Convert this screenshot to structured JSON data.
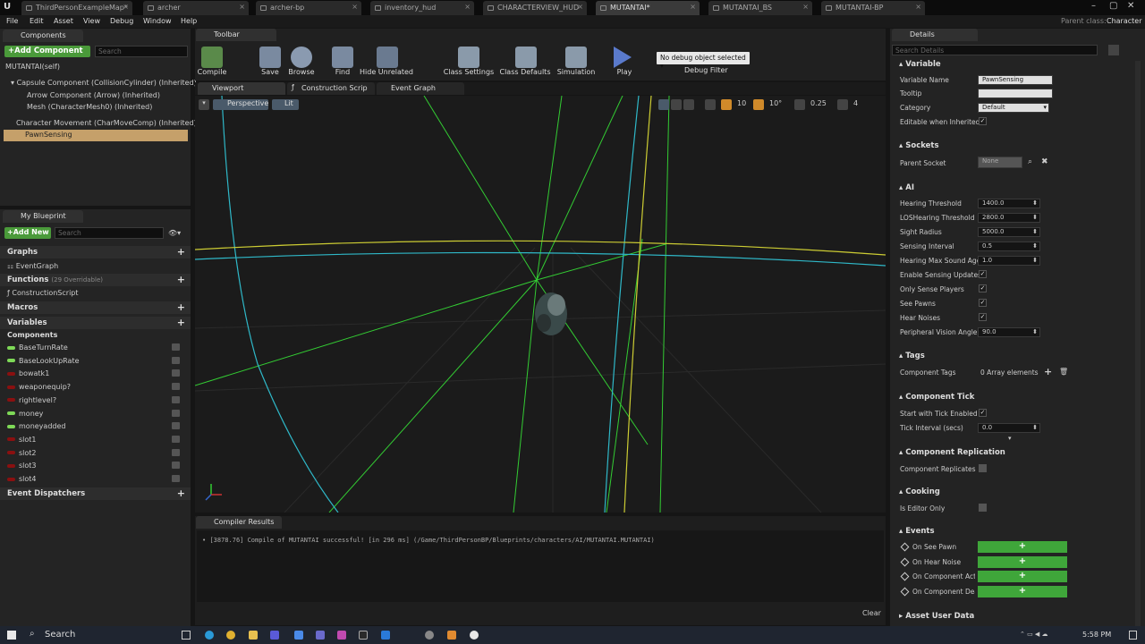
{
  "tabs": [
    {
      "label": "ThirdPersonExampleMap*",
      "active": false
    },
    {
      "label": "archer",
      "active": false
    },
    {
      "label": "archer-bp",
      "active": false
    },
    {
      "label": "inventory_hud",
      "active": false
    },
    {
      "label": "CHARACTERVIEW_HUD",
      "active": false
    },
    {
      "label": "MUTANTAI*",
      "active": true
    },
    {
      "label": "MUTANTAI_BS",
      "active": false
    },
    {
      "label": "MUTANTAI-BP",
      "active": false
    }
  ],
  "parent_class": {
    "label": "Parent class:",
    "value": "Character"
  },
  "menu": [
    "File",
    "Edit",
    "Asset",
    "View",
    "Debug",
    "Window",
    "Help"
  ],
  "components_panel": {
    "title": "Components",
    "add_button": "+Add Component",
    "search_placeholder": "Search",
    "self_item": "MUTANTAI(self)",
    "items": [
      "Capsule Component (CollisionCylinder) (Inherited)",
      "Arrow Component (Arrow) (Inherited)",
      "Mesh (CharacterMesh0) (Inherited)",
      "Character Movement (CharMoveComp) (Inherited)",
      "PawnSensing"
    ]
  },
  "my_blueprint": {
    "title": "My Blueprint",
    "add_button": "+Add New",
    "search_placeholder": "Search",
    "graphs_label": "Graphs",
    "event_graph": "EventGraph",
    "functions_label": "Functions",
    "functions_overridable": "(29 Overridable)",
    "construction_script": "ConstructionScript",
    "macros_label": "Macros",
    "variables_label": "Variables",
    "components_label": "Components",
    "variables": [
      {
        "name": "BaseTurnRate",
        "color": "#7ed957"
      },
      {
        "name": "BaseLookUpRate",
        "color": "#7ed957"
      },
      {
        "name": "bowatk1",
        "color": "#8a1010"
      },
      {
        "name": "weaponequip?",
        "color": "#8a1010"
      },
      {
        "name": "rightlevel?",
        "color": "#8a1010"
      },
      {
        "name": "money",
        "color": "#7ed957"
      },
      {
        "name": "moneyadded",
        "color": "#7ed957"
      },
      {
        "name": "slot1",
        "color": "#8a1010"
      },
      {
        "name": "slot2",
        "color": "#8a1010"
      },
      {
        "name": "slot3",
        "color": "#8a1010"
      },
      {
        "name": "slot4",
        "color": "#8a1010"
      }
    ],
    "event_dispatchers_label": "Event Dispatchers"
  },
  "toolbar": {
    "title": "Toolbar",
    "buttons": [
      "Compile",
      "Save",
      "Browse",
      "Find",
      "Hide Unrelated",
      "Class Settings",
      "Class Defaults",
      "Simulation",
      "Play"
    ],
    "debug_select": "No debug object selected",
    "debug_filter": "Debug Filter"
  },
  "editor_tabs": [
    "Viewport",
    "Construction Scrip",
    "Event Graph"
  ],
  "viewport": {
    "perspective": "Perspective",
    "lit": "Lit",
    "grid_size": "10",
    "rotation": "10°",
    "scale": "0.25",
    "camera_speed": "4"
  },
  "compiler": {
    "title": "Compiler Results",
    "message": "[3878.76] Compile of MUTANTAI successful! [in 296 ms] (/Game/ThirdPersonBP/Blueprints/characters/AI/MUTANTAI.MUTANTAI)",
    "clear": "Clear"
  },
  "details": {
    "title": "Details",
    "search_placeholder": "Search Details",
    "variable_section": "Variable",
    "variable_name_label": "Variable Name",
    "variable_name_value": "PawnSensing",
    "tooltip_label": "Tooltip",
    "category_label": "Category",
    "category_value": "Default",
    "editable_label": "Editable when Inherited",
    "sockets_section": "Sockets",
    "parent_socket_label": "Parent Socket",
    "parent_socket_value": "None",
    "ai_section": "AI",
    "ai_fields": [
      {
        "label": "Hearing Threshold",
        "value": "1400.0"
      },
      {
        "label": "LOSHearing Threshold",
        "value": "2800.0"
      },
      {
        "label": "Sight Radius",
        "value": "5000.0"
      },
      {
        "label": "Sensing Interval",
        "value": "0.5"
      },
      {
        "label": "Hearing Max Sound Age",
        "value": "1.0"
      }
    ],
    "ai_checks": [
      {
        "label": "Enable Sensing Updates",
        "checked": true
      },
      {
        "label": "Only Sense Players",
        "checked": true
      },
      {
        "label": "See Pawns",
        "checked": true
      },
      {
        "label": "Hear Noises",
        "checked": true
      }
    ],
    "peripheral_label": "Peripheral Vision Angle",
    "peripheral_value": "90.0",
    "tags_section": "Tags",
    "component_tags_label": "Component Tags",
    "component_tags_value": "0 Array elements",
    "tick_section": "Component Tick",
    "start_tick_label": "Start with Tick Enabled",
    "tick_interval_label": "Tick Interval (secs)",
    "tick_interval_value": "0.0",
    "replication_section": "Component Replication",
    "replicates_label": "Component Replicates",
    "cooking_section": "Cooking",
    "editor_only_label": "Is Editor Only",
    "events_section": "Events",
    "events": [
      "On See Pawn",
      "On Hear Noise",
      "On Component Activ",
      "On Component Deac"
    ],
    "asset_user_data": "Asset User Data"
  },
  "taskbar": {
    "search": "Search",
    "time": "5:58 PM"
  }
}
